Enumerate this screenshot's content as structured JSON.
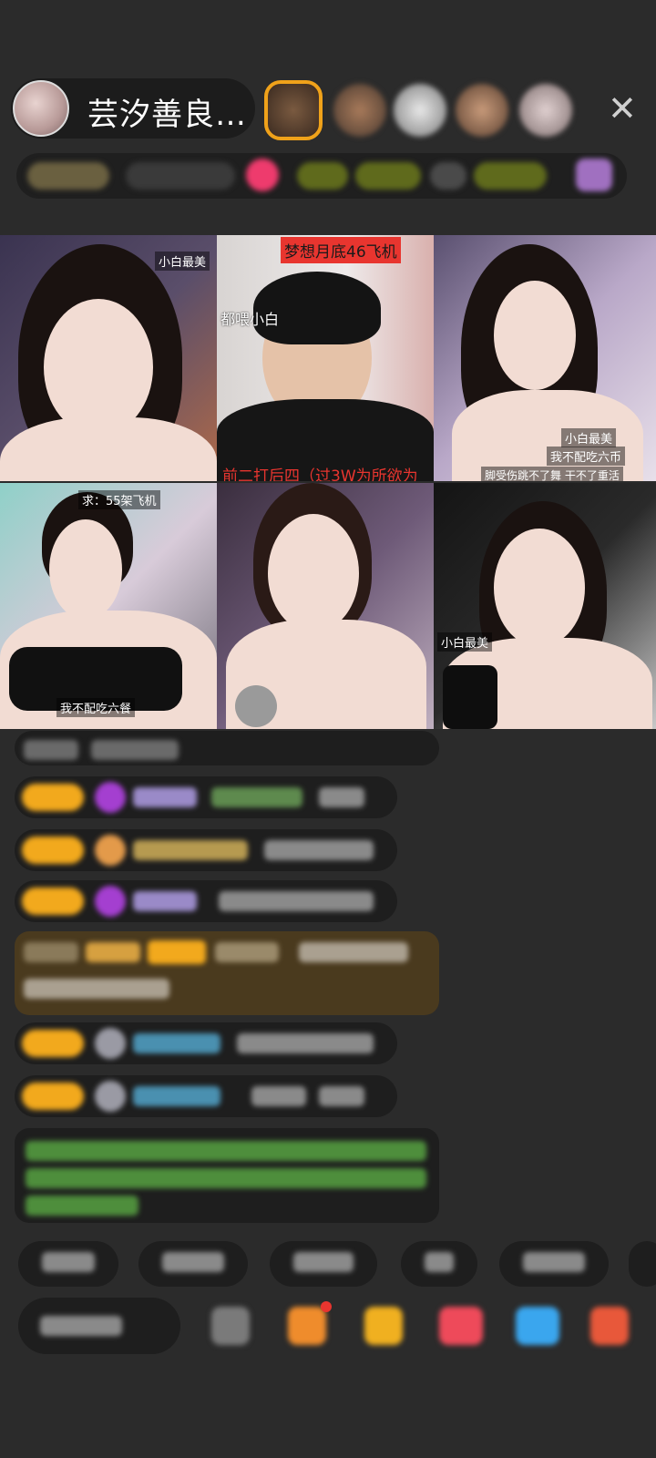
{
  "header": {
    "host_name": "芸汐善良…",
    "close_icon": "close-icon"
  },
  "video_grid": {
    "cells": [
      {
        "labels": [
          "小白最美"
        ]
      },
      {
        "banner": "梦想月底46飞机",
        "tag": "都喂小白",
        "caption": "前二打后四（过3W为所欲为"
      },
      {
        "labels": [
          "小白最美",
          "我不配吃六币",
          "脚受伤跳不了舞 干不了重活"
        ]
      },
      {
        "banner": "求：55架飞机",
        "labels": [
          "我不配吃六餐"
        ]
      },
      {
        "labels": []
      },
      {
        "labels": [
          "小白最美"
        ]
      }
    ]
  },
  "colors": {
    "background": "#2b2b2b",
    "level_badge": "#f2a91d",
    "banner_red": "#e8352f",
    "caption_red": "#e8352f",
    "label_yellow": "#f7d51d"
  }
}
